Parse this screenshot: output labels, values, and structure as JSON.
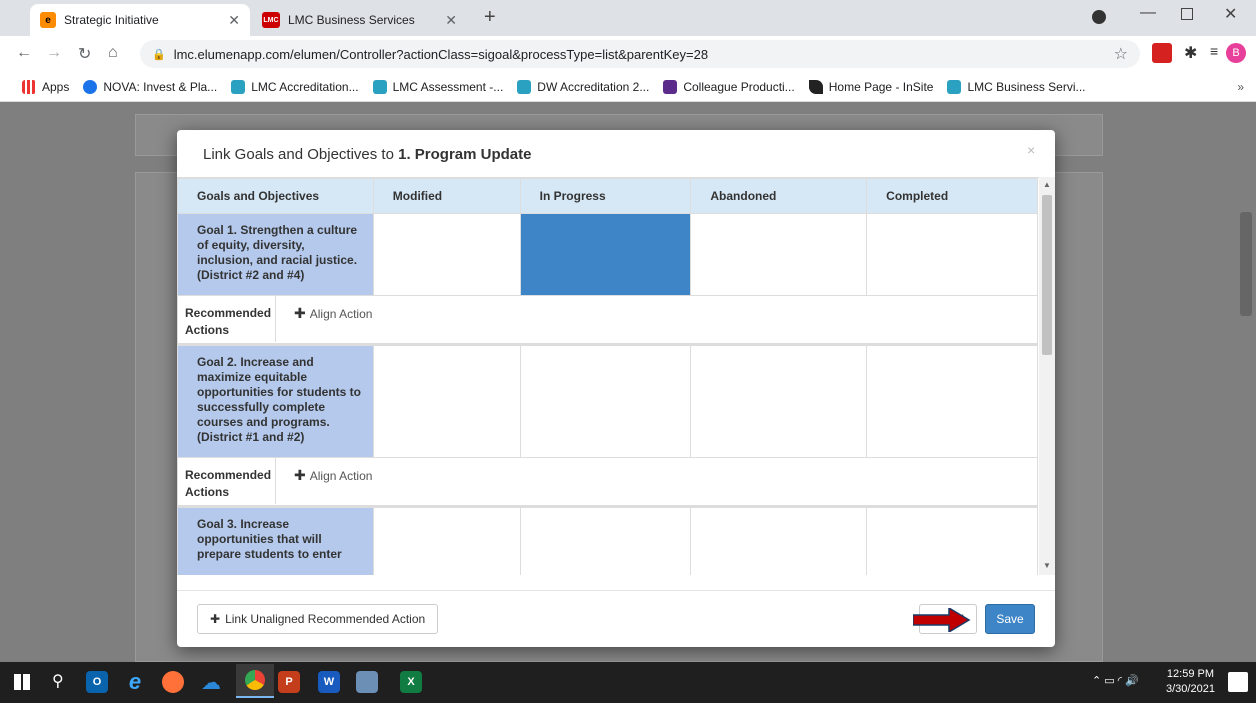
{
  "browser": {
    "tabs": [
      {
        "title": "Strategic Initiative",
        "favicon": "e"
      },
      {
        "title": "LMC Business Services",
        "favicon": "LMC"
      }
    ],
    "url": "lmc.elumenapp.com/elumen/Controller?actionClass=sigoal&processType=list&parentKey=28",
    "profile_initial": "B"
  },
  "bookmarks": [
    "Apps",
    "NOVA: Invest & Pla...",
    "LMC Accreditation...",
    "LMC Assessment -...",
    "DW Accreditation 2...",
    "Colleague Producti...",
    "Home Page - InSite",
    "LMC Business Servi..."
  ],
  "modal": {
    "title_prefix": "Link Goals and Objectives to ",
    "title_bold": "1. Program Update",
    "columns": [
      "Goals and Objectives",
      "Modified",
      "In Progress",
      "Abandoned",
      "Completed"
    ],
    "goals": [
      {
        "text": "Goal 1. Strengthen a culture of equity, diversity, inclusion, and racial justice. (District #2 and #4)",
        "status": "In Progress"
      },
      {
        "text": "Goal 2. Increase and maximize equitable opportunities for students to successfully complete courses and programs. (District #1 and #2)",
        "status": ""
      },
      {
        "text": "Goal 3. Increase opportunities that will prepare students to enter",
        "status": ""
      }
    ],
    "recommended_label": "Recommended Actions",
    "align_action": "Align Action",
    "link_unaligned": "Link Unaligned Recommended Action",
    "close_label": "l",
    "save_label": "Save"
  },
  "taskbar": {
    "time": "12:59 PM",
    "date": "3/30/2021"
  },
  "colors": {
    "in_progress": "#3d85c6",
    "goal_cell": "#b4c9ec",
    "header": "#d6e8f5",
    "arrow": "#c00000"
  }
}
